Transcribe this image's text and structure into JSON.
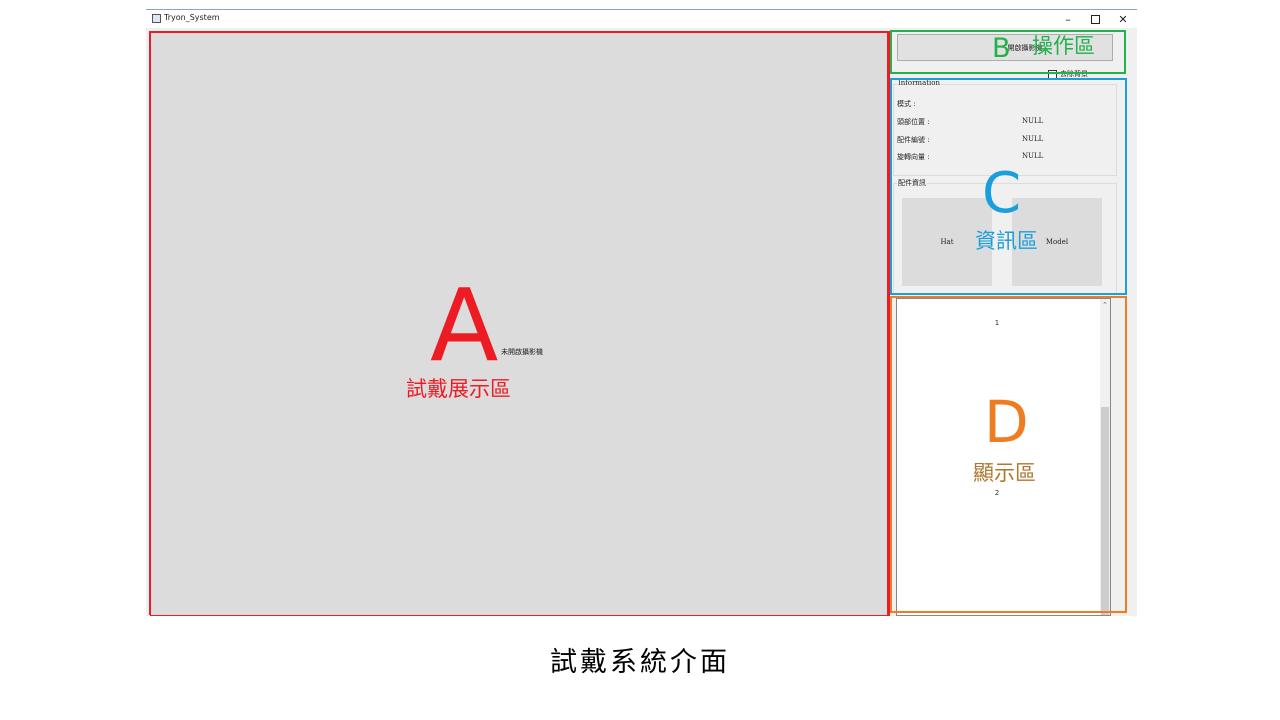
{
  "window": {
    "title": "Tryon_System",
    "controls": {
      "minimize": "–",
      "close": "✕"
    }
  },
  "display": {
    "status": "未開啟攝影機"
  },
  "operation": {
    "camera_button": "開啟攝影機",
    "remove_background": "去除背景"
  },
  "information": {
    "legend": "Information",
    "rows": [
      {
        "label": "模式 :",
        "value": ""
      },
      {
        "label": "頭部位置 :",
        "value": "NULL"
      },
      {
        "label": "配件編號 :",
        "value": "NULL"
      },
      {
        "label": "旋轉向量 :",
        "value": "NULL"
      }
    ]
  },
  "accessory": {
    "legend": "配件資訊",
    "hat": "Hat",
    "model": "Model"
  },
  "list": {
    "items": [
      "1",
      "2"
    ]
  },
  "annotations": {
    "a": {
      "letter": "A",
      "label": "試戴展示區",
      "color": "#ed1c24"
    },
    "b": {
      "letter": "B",
      "label": "操作區",
      "color": "#22b14c"
    },
    "c": {
      "letter": "C",
      "label": "資訊區",
      "color": "#1a9fdc"
    },
    "d": {
      "letter": "D",
      "label": "顯示區",
      "color": "#ee7d22"
    }
  },
  "caption": "試戴系統介面"
}
